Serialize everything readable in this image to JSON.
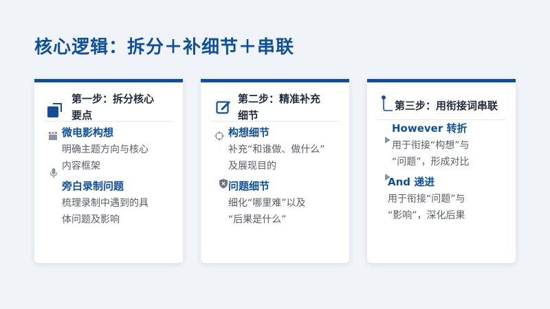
{
  "page": {
    "title": "核心逻辑：拆分＋补细节＋串联"
  },
  "colors": {
    "accent": "#0d4f9a",
    "text": "#555d68",
    "heading": "#1f2a3a",
    "background": "#f0f3f8"
  },
  "cards": [
    {
      "icon": "square-split-icon",
      "header_lines": [
        "第一步：拆分核心",
        "要点"
      ],
      "sections": [
        {
          "icon": "film-clapper-icon",
          "title": "微电影构想",
          "lines": [
            "明确主题方向与核心",
            "内容框架"
          ]
        },
        {
          "icon": "microphone-icon",
          "title": "旁白录制问题",
          "lines": [
            "梳理录制中遇到的具",
            "体问题及影响"
          ]
        }
      ]
    },
    {
      "icon": "edit-pencil-icon",
      "header_lines": [
        "第二步：精准补充",
        "细节"
      ],
      "sections": [
        {
          "icon": "crosshair-icon",
          "title": "构想细节",
          "lines": [
            "补充“和谁做、做什么”",
            "及展现目的"
          ]
        },
        {
          "icon": "shield-x-icon",
          "title": "问题细节",
          "lines": [
            "细化“哪里难”以及",
            "“后果是什么”"
          ]
        }
      ]
    },
    {
      "icon": "link-path-icon",
      "header_lines": [
        "第三步：用衔接词串联"
      ],
      "sections": [
        {
          "icon": "triangle-right-icon",
          "title": "However 转折",
          "lines": [
            "用于衔接“构想”与",
            "“问题”，形成对比"
          ]
        },
        {
          "icon": "triangle-right-icon",
          "title": "And 递进",
          "lines": [
            "用于衔接“问题”与",
            "“影响”，深化后果"
          ]
        }
      ]
    }
  ]
}
